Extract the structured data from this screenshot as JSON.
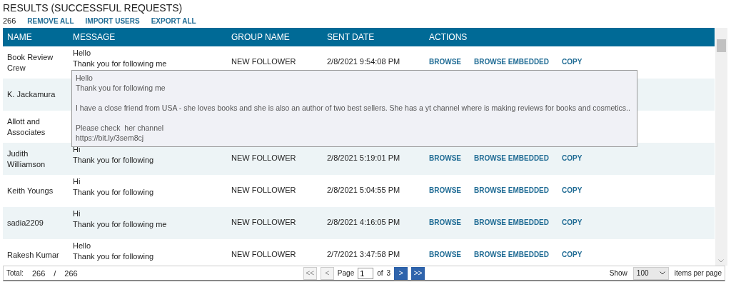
{
  "title": "RESULTS (SUCCESSFUL REQUESTS)",
  "toolbar": {
    "count": "266",
    "actions": [
      "REMOVE ALL",
      "IMPORT USERS",
      "EXPORT ALL"
    ]
  },
  "table": {
    "columns": [
      "NAME",
      "MESSAGE",
      "GROUP NAME",
      "SENT DATE",
      "ACTIONS"
    ],
    "rows": [
      {
        "name": "Book Review Crew",
        "message": [
          "Hello",
          "Thank you for following me"
        ],
        "group": "NEW FOLLOWER",
        "date": "2/8/2021 9:54:08 PM",
        "actions": [
          "BROWSE",
          "BROWSE EMBEDDED",
          "COPY"
        ]
      },
      {
        "name": "K. Jackamura"
      },
      {
        "name": "Allott and Associates"
      },
      {
        "name": "Judith Williamson",
        "message": [
          "Hi",
          "Thank you for following"
        ],
        "group": "NEW FOLLOWER",
        "date": "2/8/2021 5:19:01 PM",
        "actions": [
          "BROWSE",
          "BROWSE EMBEDDED",
          "COPY"
        ]
      },
      {
        "name": "Keith Youngs",
        "message": [
          "Hi",
          "Thank you for following"
        ],
        "group": "NEW FOLLOWER",
        "date": "2/8/2021 5:04:55 PM",
        "actions": [
          "BROWSE",
          "BROWSE EMBEDDED",
          "COPY"
        ]
      },
      {
        "name": "sadia2209",
        "message": [
          "Hi",
          "Thank you for following me"
        ],
        "group": "NEW FOLLOWER",
        "date": "2/8/2021 4:16:05 PM",
        "actions": [
          "BROWSE",
          "BROWSE EMBEDDED",
          "COPY"
        ]
      },
      {
        "name": "Rakesh Kumar",
        "message": [
          "Hello",
          "Thank you for following"
        ],
        "group": "NEW FOLLOWER",
        "date": "2/7/2021 3:47:58 PM",
        "actions": [
          "BROWSE",
          "BROWSE EMBEDDED",
          "COPY"
        ]
      }
    ]
  },
  "tooltip": {
    "paragraphs": [
      [
        "Hello",
        "Thank you for following me"
      ],
      [
        "I have a close friend from USA - she loves books and she is also an author of two best sellers. She has a yt channel where is making reviews for books and cosmetics.."
      ],
      [
        "Please check  her channel",
        "https://bit.ly/3sem8cj"
      ]
    ]
  },
  "footer": {
    "total_label": "Total:",
    "total": "266",
    "separator": "/",
    "total_all": "266",
    "pager": [
      {
        "label": "<<",
        "disabled": true
      },
      {
        "label": "<",
        "disabled": true
      }
    ],
    "page_label": "Page",
    "page": "1",
    "of_label": "of",
    "pages": "3",
    "pager_next": [
      {
        "label": ">",
        "disabled": false
      },
      {
        "label": ">>",
        "disabled": false
      }
    ],
    "show_label": "Show",
    "per_page": "100",
    "per_page_label": "items per page"
  }
}
